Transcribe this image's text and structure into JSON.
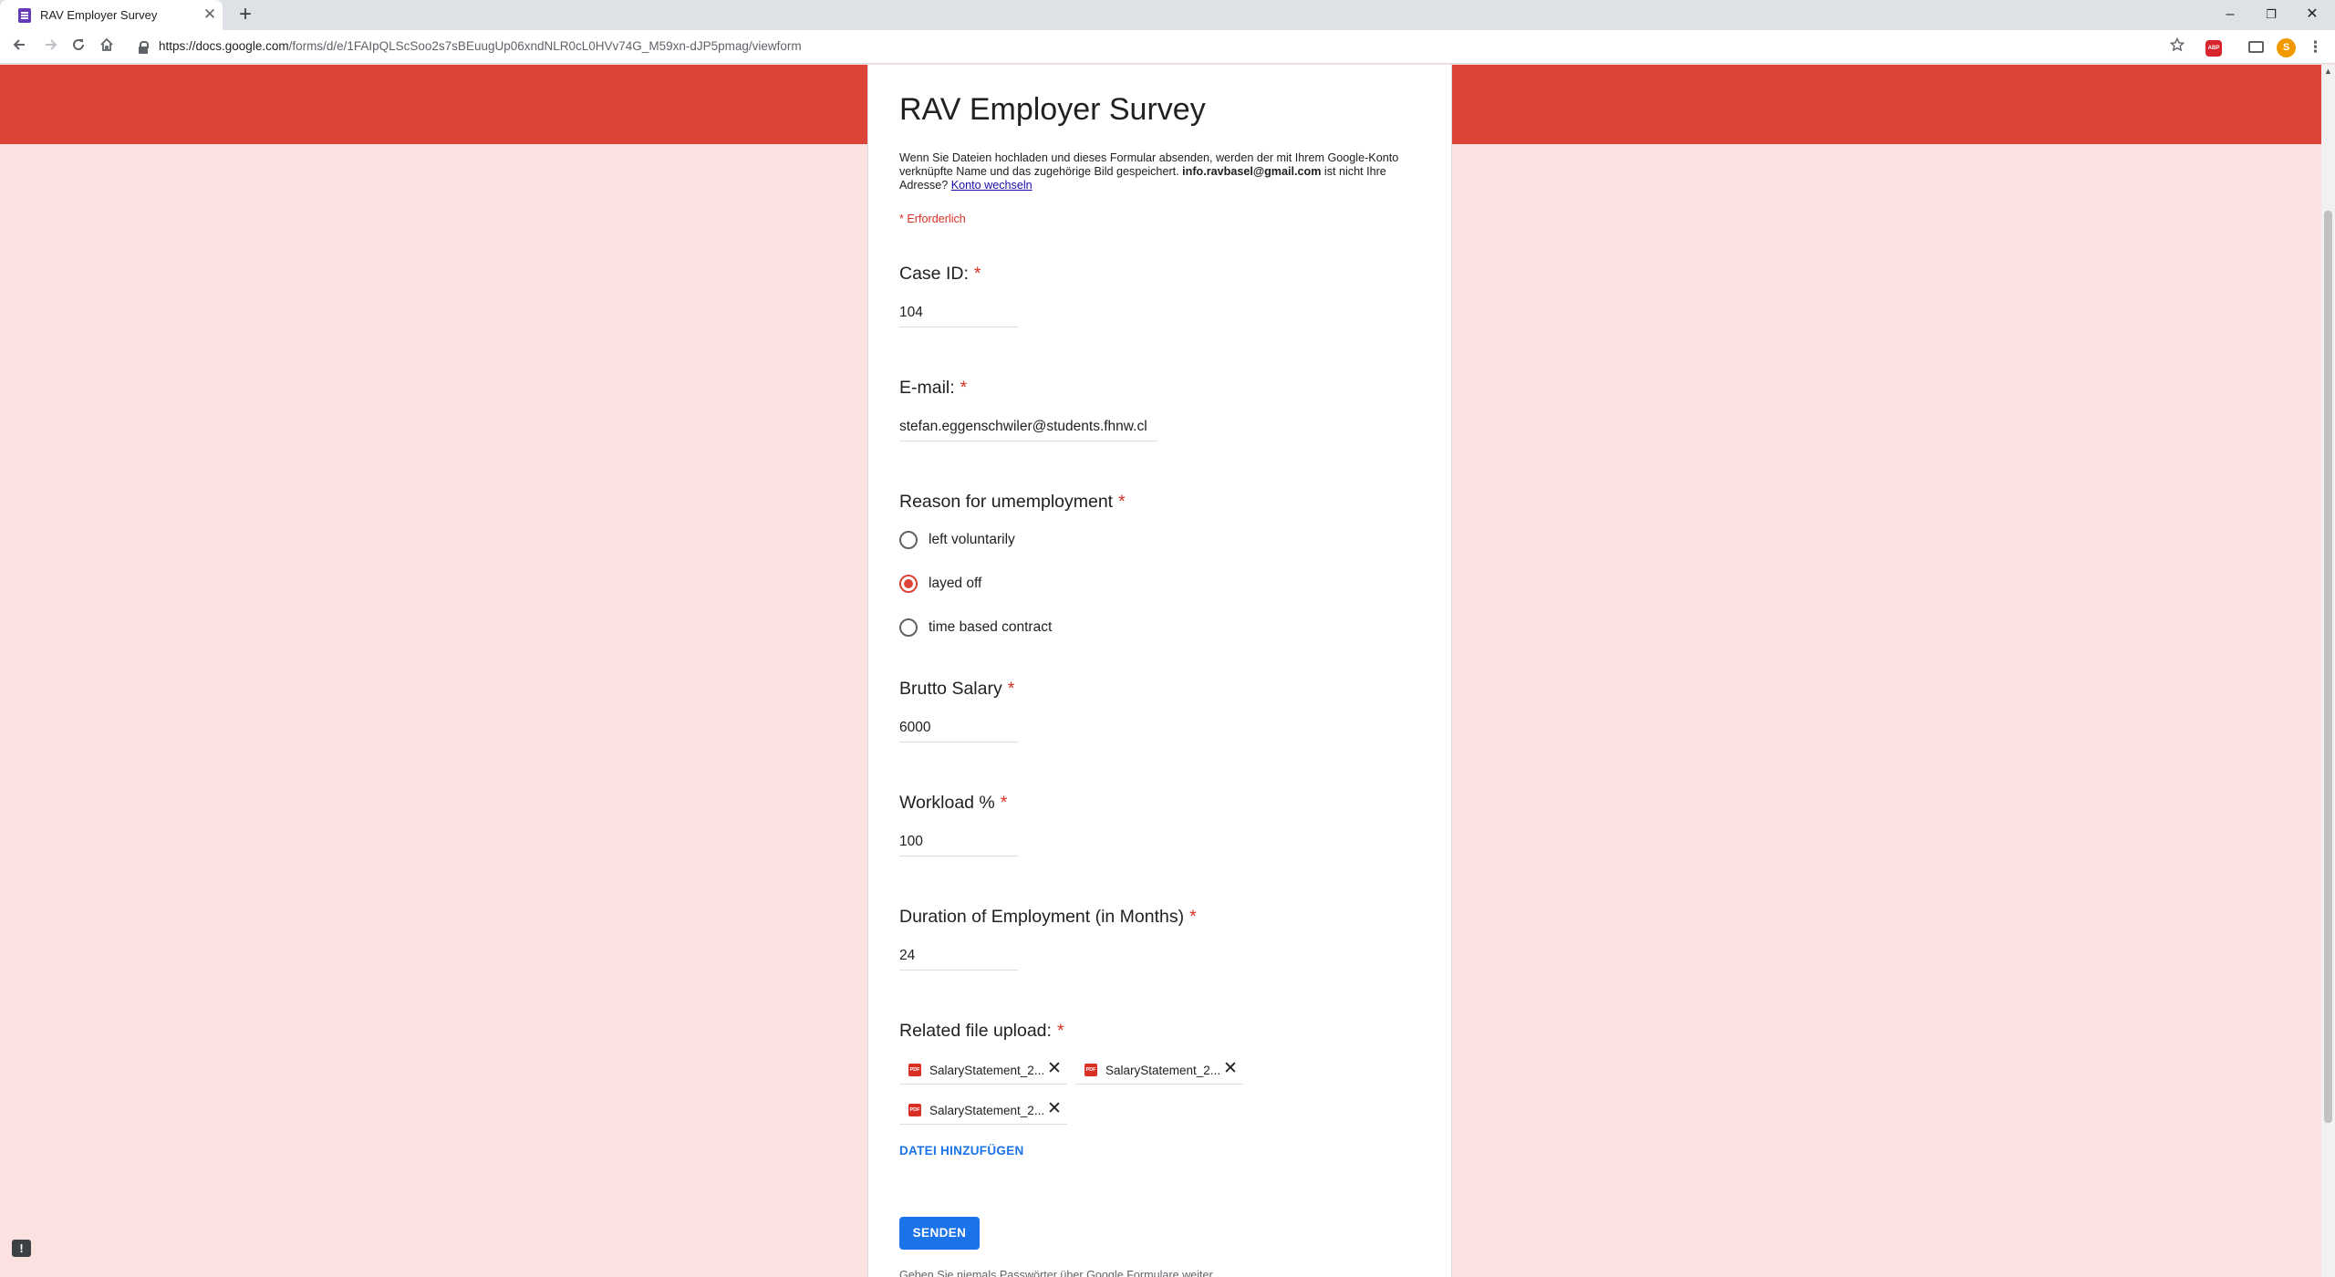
{
  "browser": {
    "tab_title": "RAV Employer Survey",
    "tab_close": "✕",
    "new_tab": "+",
    "url_host": "https://docs.google.com",
    "url_path": "/forms/d/e/1FAIpQLScSoo2s7sBEuugUp06xndNLR0cL0HVv74G_M59xn-dJP5pmag/viewform",
    "icons": {
      "back": "arrow-left",
      "forward": "arrow-right",
      "reload": "reload",
      "home": "home",
      "bookmark": "star",
      "adblock": "ABP",
      "cast": "cast",
      "profile": "S",
      "menu": "⋮"
    },
    "window_controls": [
      "–",
      "❐",
      "✕"
    ]
  },
  "form": {
    "title": "RAV Employer Survey",
    "description_text": "Wenn Sie Dateien hochladen und dieses Formular absenden, werden der mit Ihrem Google-Konto verknüpfte Name und das zugehörige Bild gespeichert.",
    "account_email": "info.ravbasel@gmail.com",
    "description_suffix": "ist nicht Ihre Adresse?",
    "switch_account_link": "Konto wechseln",
    "required_note": "* Erforderlich",
    "required_star": "*",
    "questions": {
      "case_id": {
        "label": "Case ID:",
        "value": "104"
      },
      "email": {
        "label": "E-mail:",
        "value": "stefan.eggenschwiler@students.fhnw.cl"
      },
      "reason": {
        "label": "Reason for umemployment",
        "options": [
          "left voluntarily",
          "layed off",
          "time based contract"
        ],
        "selected": "layed off"
      },
      "salary": {
        "label": "Brutto Salary",
        "value": "6000"
      },
      "workload": {
        "label": "Workload %",
        "value": "100"
      },
      "duration": {
        "label": "Duration of Employment (in Months)",
        "value": "24"
      },
      "upload": {
        "label": "Related file upload:",
        "files": [
          "SalaryStatement_2...",
          "SalaryStatement_2...",
          "SalaryStatement_2..."
        ],
        "file_type_badge": "PDF",
        "remove_icon": "✕",
        "add_file_label": "DATEI HINZUFÜGEN"
      }
    },
    "submit_label": "SENDEN",
    "footer_note": "Geben Sie niemals Passwörter über Google Formulare weiter."
  },
  "feedback_icon": "!",
  "colors": {
    "banner": "#db4437",
    "page_background": "#fbe2e0",
    "required": "#d93025",
    "accent": "#1a73e8"
  }
}
